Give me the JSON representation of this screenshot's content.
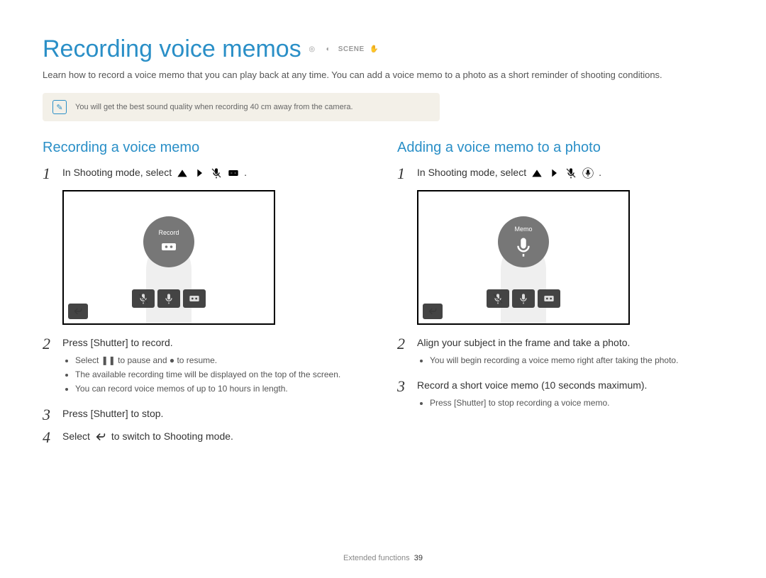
{
  "title": "Recording voice memos",
  "header_mode_labels": [
    "a",
    "p",
    "SCENE",
    "d"
  ],
  "intro": "Learn how to record a voice memo that you can play back at any time. You can add a voice memo to a photo as a short reminder of shooting conditions.",
  "tip": "You will get the best sound quality when recording 40 cm away from the camera.",
  "left": {
    "heading": "Recording a voice memo",
    "step1_prefix": "In Shooting mode, select",
    "screen_big_label": "Record",
    "step2_text": "Press [Shutter] to record.",
    "step2_bullets": [
      "Select ❚❚ to pause and ● to resume.",
      "The available recording time will be displayed on the top of the screen.",
      "You can record voice memos of up to 10 hours in length."
    ],
    "step3_text": "Press [Shutter] to stop.",
    "step4_prefix": "Select",
    "step4_suffix": "to switch to Shooting mode."
  },
  "right": {
    "heading": "Adding a voice memo to a photo",
    "step1_prefix": "In Shooting mode, select",
    "screen_big_label": "Memo",
    "step2_text": "Align your subject in the frame and take a photo.",
    "step2_bullets": [
      "You will begin recording a voice memo right after taking the photo."
    ],
    "step3_text": "Record a short voice memo (10 seconds maximum).",
    "step3_bullets": [
      "Press [Shutter] to stop recording a voice memo."
    ]
  },
  "footer_section": "Extended functions",
  "footer_page": "39"
}
